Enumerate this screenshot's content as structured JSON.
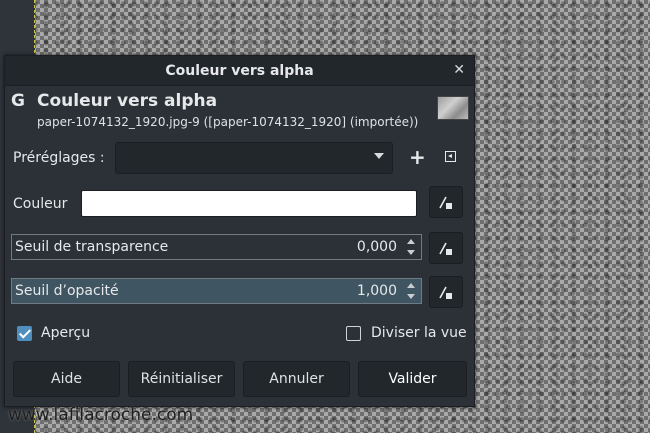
{
  "dialog": {
    "window_title": "Couleur vers alpha",
    "header_title": "Couleur vers alpha",
    "header_subtitle": "paper-1074132_1920.jpg-9 ([paper-1074132_1920] (importée))",
    "logo_letter": "G"
  },
  "presets": {
    "label": "Préréglages :",
    "value": ""
  },
  "color": {
    "label": "Couleur",
    "value_hex": "#ffffff"
  },
  "transparency": {
    "label": "Seuil de transparence",
    "value": "0,000"
  },
  "opacity": {
    "label": "Seuil d’opacité",
    "value": "1,000"
  },
  "options": {
    "preview_label": "Aperçu",
    "preview_checked": true,
    "split_label": "Diviser la vue",
    "split_checked": false
  },
  "buttons": {
    "help": "Aide",
    "reset": "Réinitialiser",
    "cancel": "Annuler",
    "ok": "Valider"
  },
  "watermark": "www.lafilacroche.com",
  "colors": {
    "dialog_bg": "#2b3137",
    "accent": "#4f8fbf",
    "slider_fill": "#4a6472"
  }
}
